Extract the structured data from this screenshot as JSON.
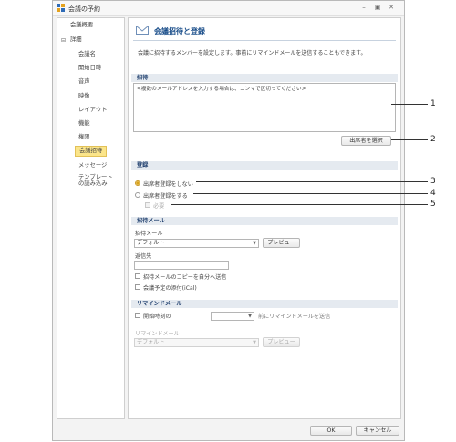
{
  "window": {
    "title": "会議の予約"
  },
  "nav": {
    "items": [
      {
        "label": "会議概要"
      },
      {
        "label": "詳細"
      },
      {
        "label": "会議名"
      },
      {
        "label": "開始日時"
      },
      {
        "label": "音声"
      },
      {
        "label": "映像"
      },
      {
        "label": "レイアウト"
      },
      {
        "label": "機能"
      },
      {
        "label": "権限"
      },
      {
        "label": "会議招待"
      },
      {
        "label": "メッセージ"
      },
      {
        "label": "テンプレート"
      },
      {
        "label": "の読み込み"
      }
    ],
    "toggle": "⊟"
  },
  "header": {
    "title": "会議招待と登録",
    "description": "会議に招待するメンバーを設定します。事前にリマインドメールを送信することもできます。"
  },
  "invite": {
    "section": "招待",
    "placeholder": "<複数のメールアドレスを入力する場合は、コンマで区切ってください>",
    "select_attendees": "出席者を選択"
  },
  "registration": {
    "section": "登録",
    "no_register": "出席者登録をしない",
    "register": "出席者登録をする",
    "required": "必要"
  },
  "invite_mail": {
    "section": "招待メール",
    "template_label": "招待メール",
    "template_value": "デフォルト",
    "preview": "プレビュー",
    "reply_to_label": "返信先",
    "reply_to_value": "",
    "copy_to_self": "招待メールのコピーを自分へ送信",
    "attach_ical": "会議予定の添付(iCal)"
  },
  "reminder": {
    "section": "リマインドメール",
    "start_label": "開始時刻の",
    "start_value": "",
    "before_send": "前にリマインドメールを送信",
    "mail_label": "リマインドメール",
    "mail_value": "デフォルト",
    "preview": "プレビュー"
  },
  "footer": {
    "ok": "OK",
    "cancel": "キャンセル"
  },
  "callouts": [
    "1",
    "2",
    "3",
    "4",
    "5"
  ],
  "colors": {
    "accent": "#1a4e8a",
    "selected_nav": "#fbe58a",
    "section_bg": "#e5eaf0"
  }
}
